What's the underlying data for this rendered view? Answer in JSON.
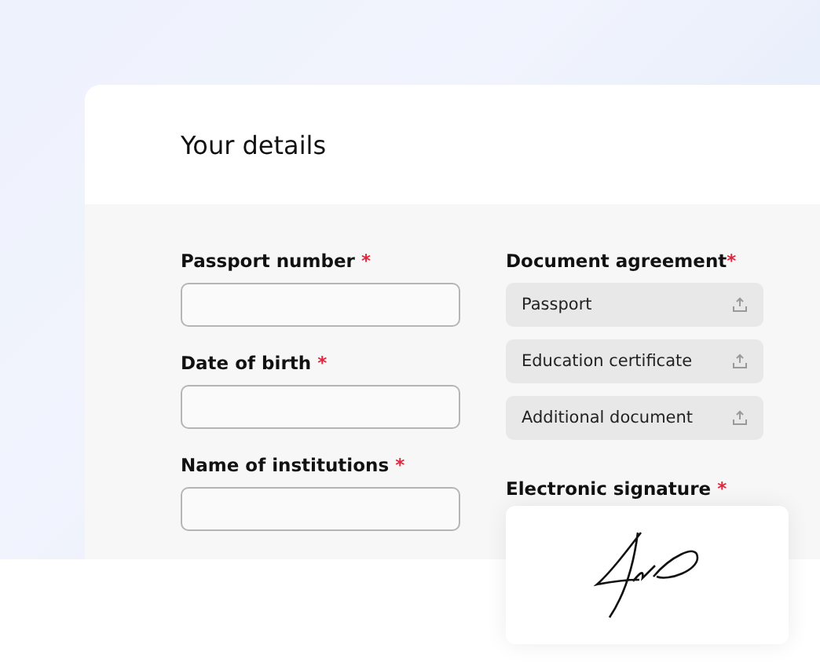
{
  "card": {
    "title": "Your details"
  },
  "fields": [
    {
      "label": "Passport number",
      "required_mark": "*"
    },
    {
      "label": "Date of birth",
      "required_mark": "*"
    },
    {
      "label": "Name of institutions",
      "required_mark": "*"
    }
  ],
  "documents": {
    "label": "Document agreement",
    "required_mark": "*",
    "items": [
      {
        "label": "Passport"
      },
      {
        "label": "Education certificate"
      },
      {
        "label": "Additional document"
      }
    ]
  },
  "signature": {
    "label": "Electronic signature",
    "required_mark": "*"
  }
}
